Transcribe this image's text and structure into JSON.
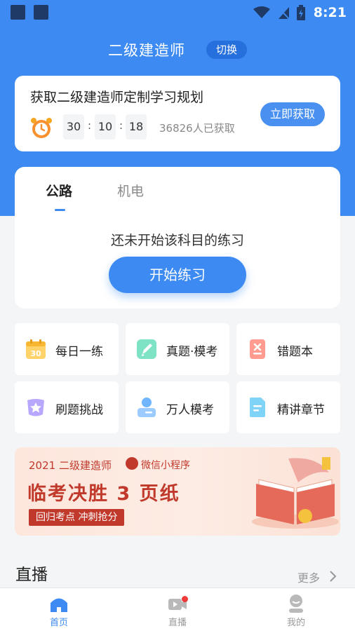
{
  "status_bar": {
    "time": "8:21"
  },
  "header": {
    "title": "二级建造师",
    "switch_label": "切换"
  },
  "plan_card": {
    "title": "获取二级建造师定制学习规划",
    "countdown": {
      "hours": "30",
      "minutes": "10",
      "seconds": "18",
      "separator": ":"
    },
    "count_text": "36826人已获取",
    "action_label": "立即获取"
  },
  "practice": {
    "tabs": [
      {
        "label": "公路",
        "active": true
      },
      {
        "label": "机电",
        "active": false
      }
    ],
    "empty_text": "还未开始该科目的练习",
    "start_label": "开始练习"
  },
  "grid": [
    {
      "label": "每日一练",
      "icon": "calendar-icon"
    },
    {
      "label": "真题·模考",
      "icon": "pen-icon"
    },
    {
      "label": "错题本",
      "icon": "error-book-icon"
    },
    {
      "label": "刷题挑战",
      "icon": "star-badge-icon"
    },
    {
      "label": "万人模考",
      "icon": "user-card-icon"
    },
    {
      "label": "精讲章节",
      "icon": "document-icon"
    }
  ],
  "banner": {
    "year_line": "2021 二级建造师",
    "mini_program": "微信小程序",
    "headline": "临考决胜 3 页纸",
    "tagline": "回归考点 冲刺抢分",
    "calendar_digits": "30"
  },
  "live": {
    "title": "直播",
    "more_label": "更多"
  },
  "bottom_nav": [
    {
      "label": "首页",
      "icon": "home-icon",
      "active": true
    },
    {
      "label": "直播",
      "icon": "video-icon",
      "active": false
    },
    {
      "label": "我的",
      "icon": "profile-icon",
      "active": false
    }
  ],
  "colors": {
    "brand_blue": "#3d8bf2",
    "banner_red": "#c0392b",
    "badge_red": "#f03a3a"
  }
}
